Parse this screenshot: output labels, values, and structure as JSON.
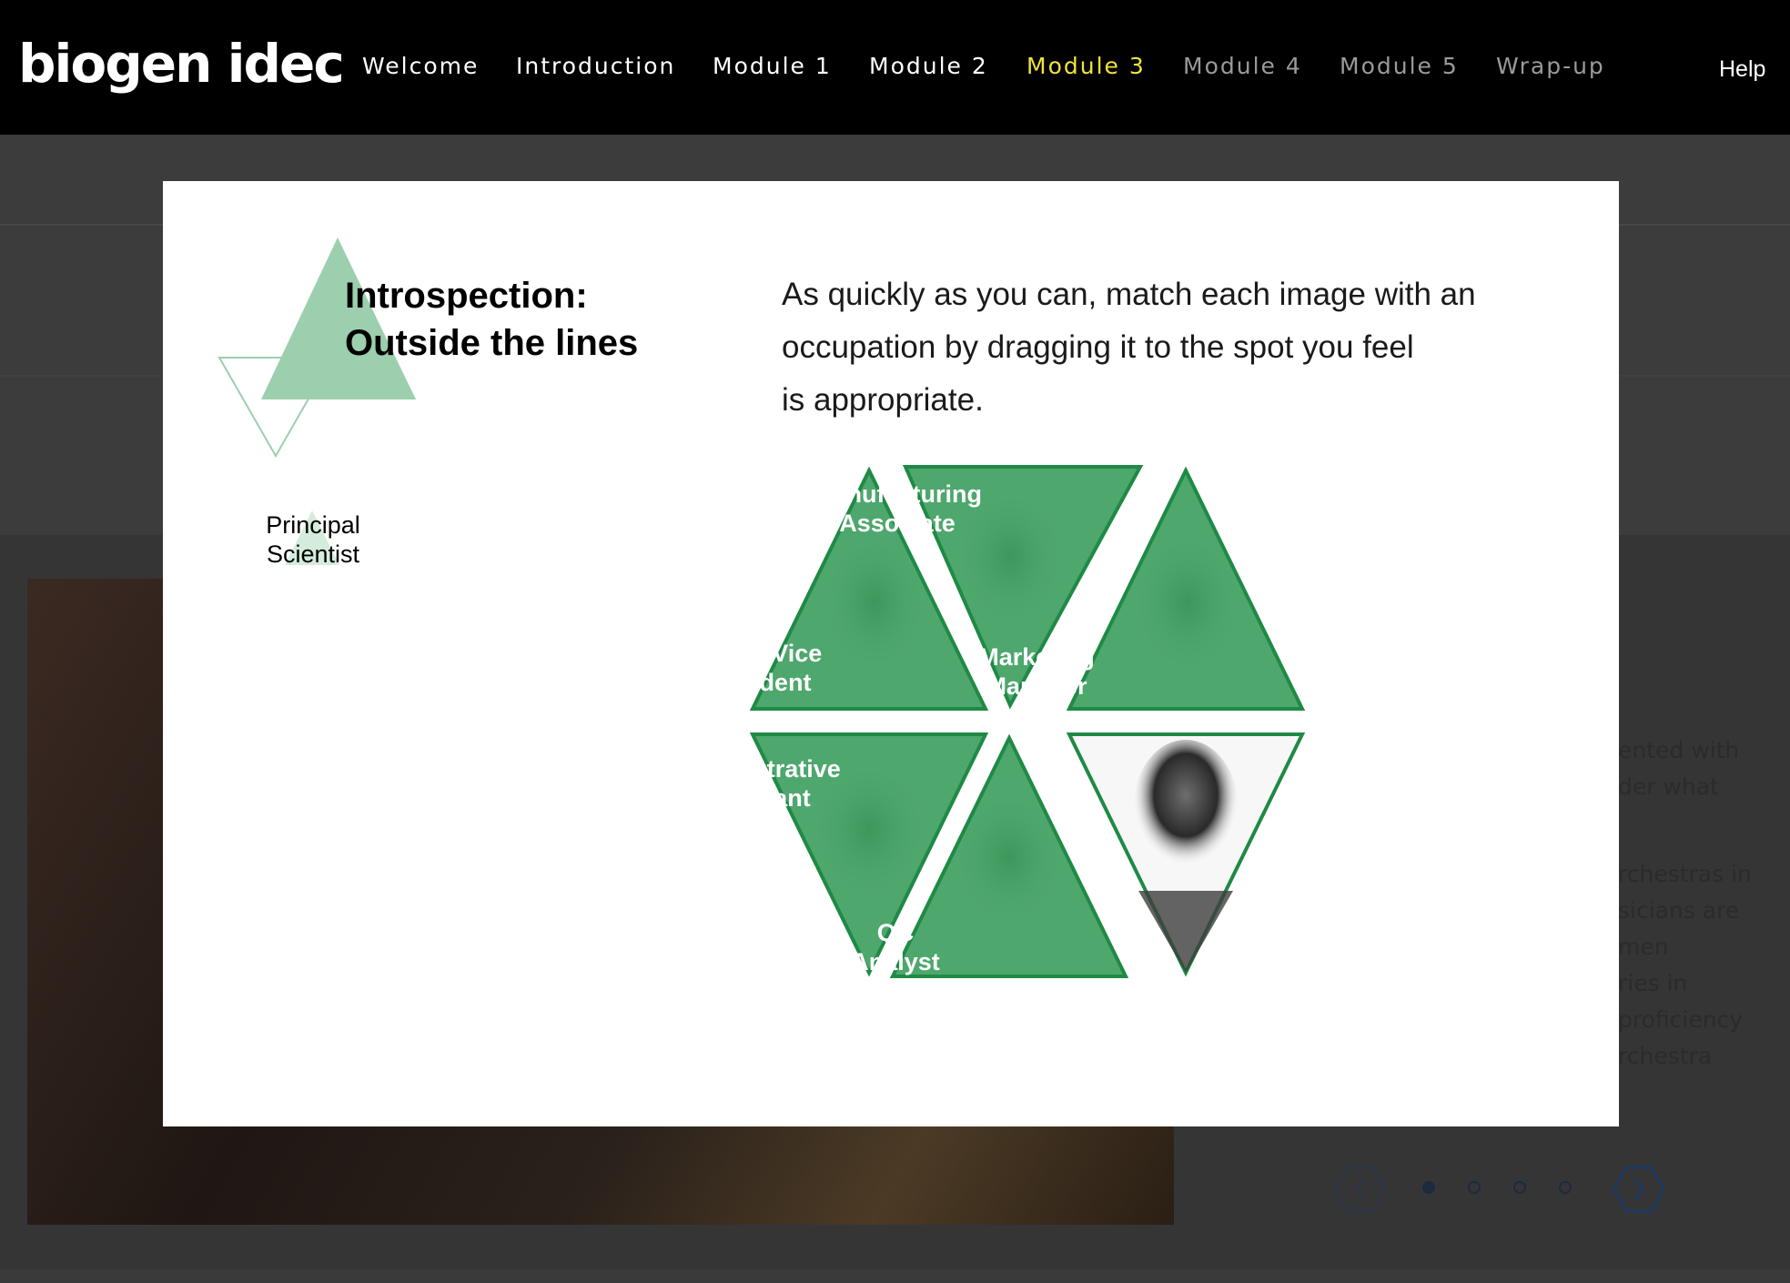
{
  "app": {
    "logo_text": "biogen idec",
    "logo_dot": "."
  },
  "nav": {
    "items": [
      {
        "label": "Welcome",
        "state": "normal"
      },
      {
        "label": "Introduction",
        "state": "normal"
      },
      {
        "label": "Module 1",
        "state": "normal"
      },
      {
        "label": "Module 2",
        "state": "normal"
      },
      {
        "label": "Module 3",
        "state": "active"
      },
      {
        "label": "Module 4",
        "state": "disabled"
      },
      {
        "label": "Module 5",
        "state": "disabled"
      },
      {
        "label": "Wrap-up",
        "state": "disabled"
      }
    ],
    "help_label": "Help"
  },
  "background": {
    "side_text_lines_a": [
      "ented with",
      "der what"
    ],
    "side_text_lines_b": [
      "rchestras in",
      "sicians are",
      "men",
      "ries in",
      "proficiency",
      "rchestra"
    ],
    "pager": {
      "prev_icon": "chevron-left-icon",
      "next_icon": "chevron-right-icon",
      "pages": 4,
      "current": 1
    }
  },
  "modal": {
    "title_line1": "Introspection:",
    "title_line2": "Outside the lines",
    "instructions_line1": "As quickly as you can, match each image with an",
    "instructions_line2": "occupation by dragging it to the spot you feel",
    "instructions_line3": "is appropriate.",
    "drag_item": {
      "line1": "Principal",
      "line2": "Scientist"
    },
    "tiles": [
      {
        "line1": "Senior Vice",
        "line2": "President",
        "state": "labeled"
      },
      {
        "line1": "Manufacturing",
        "line2": "Associate",
        "state": "labeled"
      },
      {
        "line1": "Marketing",
        "line2": "Manager",
        "state": "labeled"
      },
      {
        "line1": "Administrative",
        "line2": "Assistant",
        "state": "labeled"
      },
      {
        "line1": "QC",
        "line2": "Analyst",
        "state": "labeled"
      },
      {
        "line1": "",
        "line2": "",
        "state": "empty-photo"
      }
    ]
  },
  "colors": {
    "topbar_bg": "#000000",
    "nav_active": "#f2e33a",
    "nav_disabled": "#9a9a9a",
    "tile_green": "#4ea76d",
    "tile_border": "#1f8a45",
    "title_triangle": "#9ccfad"
  }
}
